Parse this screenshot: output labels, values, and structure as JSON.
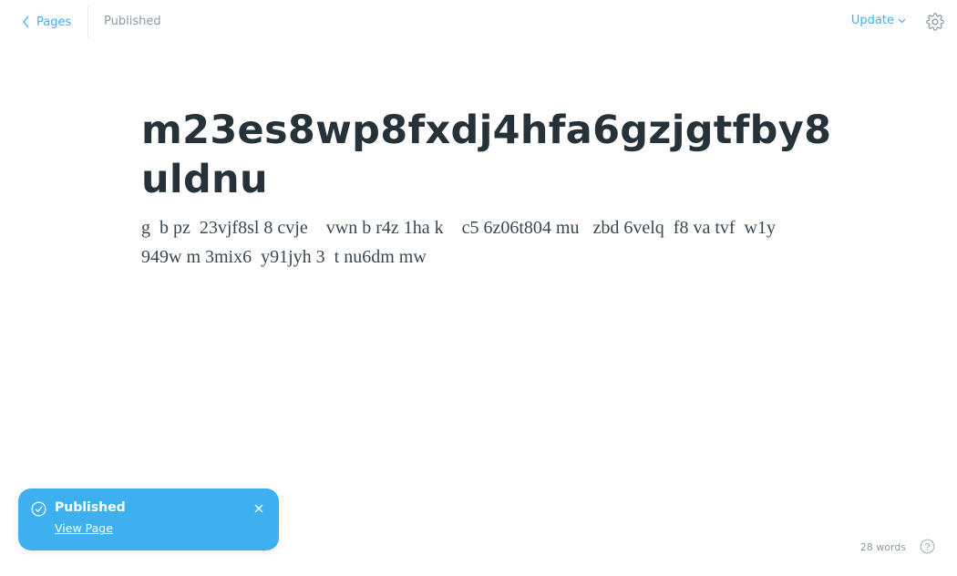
{
  "header": {
    "back_label": "Pages",
    "status": "Published",
    "update_label": "Update"
  },
  "editor": {
    "title": "m23es8wp8fxdj4hfa6gzjgtfby8uldnu",
    "body": "g  b pz  23vjf8sl 8 cvje    vwn b r4z 1ha k    c5 6z06t804 mu   zbd 6velq  f8 va tvf  w1y  949w m 3mix6  y91jyh 3  t nu6dm mw"
  },
  "toast": {
    "title": "Published",
    "link_label": "View Page"
  },
  "footer": {
    "word_count": "28 words"
  },
  "colors": {
    "accent": "#3eb0ef",
    "muted": "#8e9aa3",
    "title": "#26323a"
  },
  "icons": {
    "back": "chevron-left-icon",
    "update": "chevron-down-icon",
    "settings": "gear-icon",
    "toast": "check-circle-icon",
    "close": "close-icon",
    "help": "question-circle-icon"
  }
}
